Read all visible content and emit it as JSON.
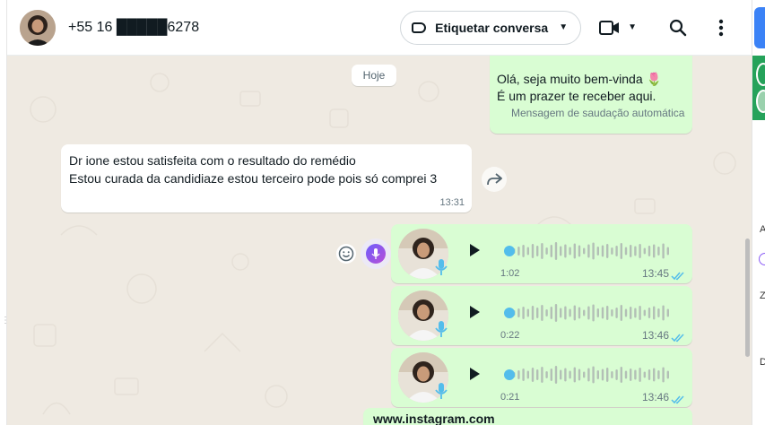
{
  "header": {
    "contact_name": "+55 16 █████6278",
    "label_button": "Etiquetar conversa"
  },
  "chat": {
    "date_chip": "Hoje",
    "greeting": {
      "line1": "Olá, seja muito bem-vinda 🌷",
      "line2": "É um prazer te receber aqui.",
      "subtitle": "Mensagem de saudação automática"
    },
    "incoming": {
      "line1": "Dr ione estou satisfeita com o resultado do remédio",
      "line2": "Estou curada da candidiaze estou terceiro pode pois só comprei 3",
      "time": "13:31"
    },
    "voice_messages": [
      {
        "duration": "1:02",
        "time": "13:45",
        "progress": 0
      },
      {
        "duration": "0:22",
        "time": "13:46",
        "progress": 0
      },
      {
        "duration": "0:21",
        "time": "13:46",
        "progress": 0
      }
    ],
    "link_preview": {
      "text": "www.instagram.com"
    }
  },
  "right_panel_letters": [
    "A",
    "Z",
    "D"
  ],
  "colors": {
    "outgoing_bubble": "#d9fdd3",
    "incoming_bubble": "#ffffff",
    "chat_background": "#efeae2",
    "read_ticks": "#53bdeb",
    "voice_accent": "#53bdeb"
  },
  "icons": [
    "label-icon",
    "video-call-icon",
    "search-icon",
    "menu-icon",
    "forward-icon",
    "emoji-icon",
    "ai-voice-icon",
    "play-icon",
    "mic-icon",
    "double-check-icon"
  ]
}
